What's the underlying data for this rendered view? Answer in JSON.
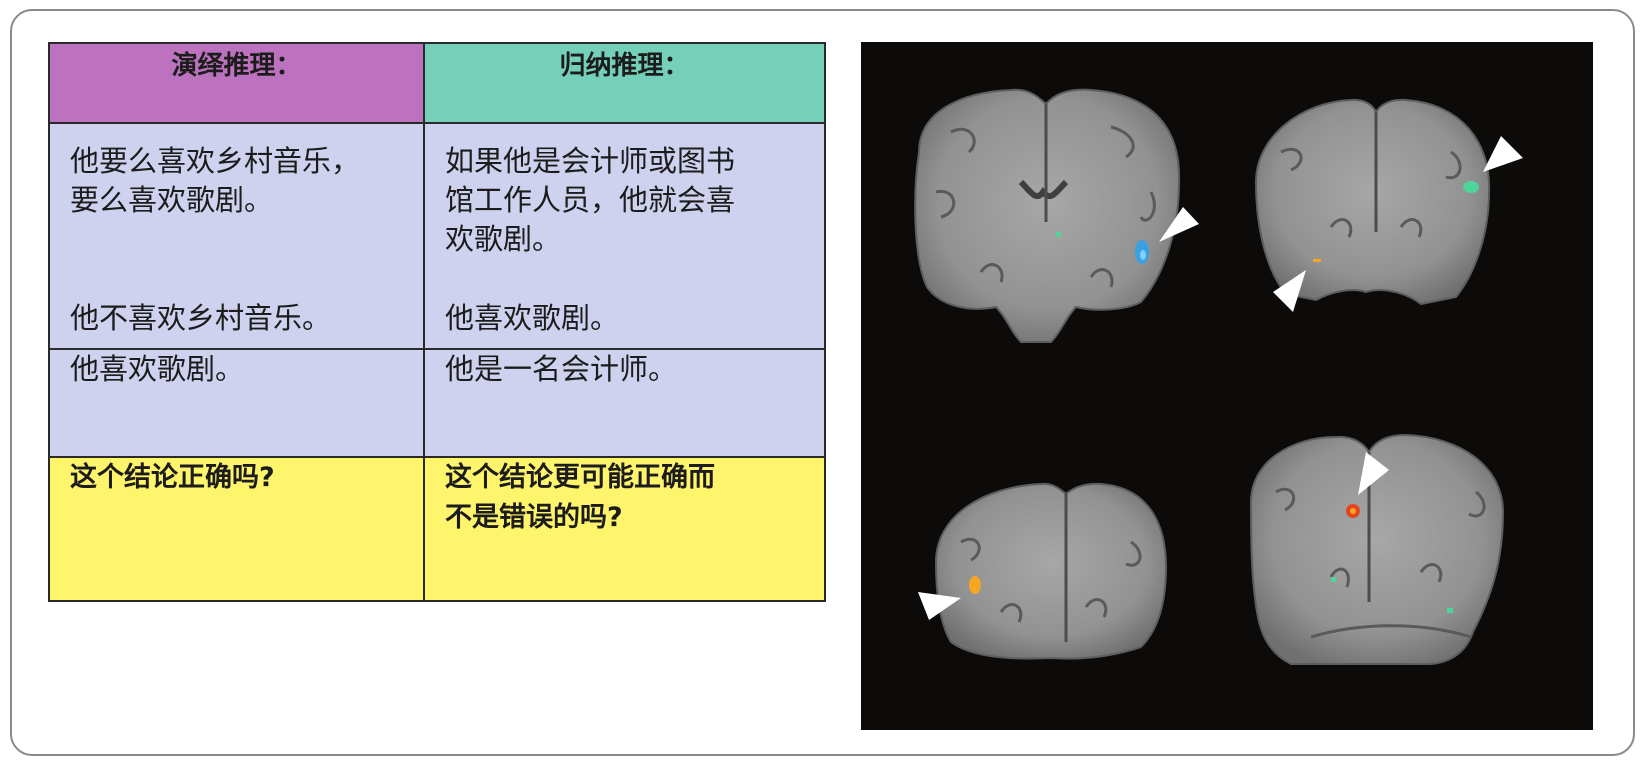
{
  "table": {
    "deductive": {
      "header": "演绎推理：",
      "premise1": "他要么喜欢乡村音乐，\n要么喜欢歌剧。",
      "premise2": "他不喜欢乡村音乐。",
      "premise3": "他喜欢歌剧。",
      "question": "这个结论正确吗?"
    },
    "inductive": {
      "header": "归纳推理：",
      "premise1": "如果他是会计师或图书\n馆工作人员，他就会喜\n欢歌剧。",
      "premise2": "他喜欢歌剧。",
      "premise3": "他是一名会计师。",
      "question": "这个结论更可能正确而\n不是错误的吗?"
    },
    "colors": {
      "deductive_header": "#bd72c0",
      "inductive_header": "#74d0b9",
      "premise_bg": "#cfd2ee",
      "question_bg": "#fef56d"
    }
  },
  "brain_panel": {
    "background": "#0c0b09",
    "activation_colors": {
      "blue": "#3aa0e0",
      "green": "#4fd49a",
      "orange": "#f5a623",
      "red": "#e2451b"
    },
    "scans": [
      {
        "name": "brain-scan-top-left",
        "activations": [
          "blue",
          "green"
        ]
      },
      {
        "name": "brain-scan-top-right",
        "activations": [
          "green",
          "orange"
        ]
      },
      {
        "name": "brain-scan-bottom-left",
        "activations": [
          "orange"
        ]
      },
      {
        "name": "brain-scan-bottom-right",
        "activations": [
          "orange",
          "green"
        ]
      }
    ]
  }
}
